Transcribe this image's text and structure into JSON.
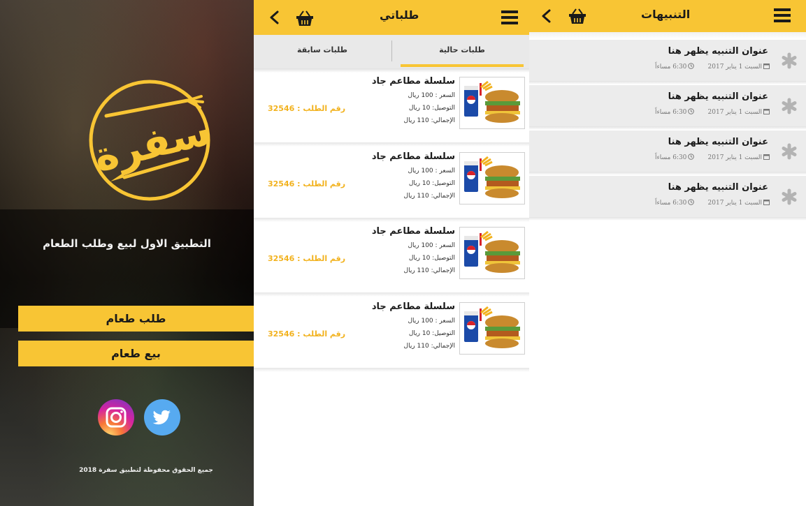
{
  "colors": {
    "accent": "#f8c534",
    "order_number": "#f2b21e",
    "card_bg": "#ececec",
    "twitter": "#57aaf0"
  },
  "splash": {
    "logo_text": "سفرة",
    "tagline": "التطبيق الاول لبيع وطلب الطعام",
    "order_food_button": "طلب طعام",
    "sell_food_button": "بيع طعام",
    "social": [
      "instagram-icon",
      "twitter-icon"
    ],
    "copyright": "جميع الحقوق محفوظة لتطبيق سفرة 2018"
  },
  "orders": {
    "title": "طلباتي",
    "tabs": {
      "current": "طلبات حالية",
      "previous": "طلبات سابقة"
    },
    "items": [
      {
        "name": "سلسلة مطاعم جاد",
        "price": "السعر : 100 ريال",
        "delivery": "التوصيل:  10 ريال",
        "total": "الإجمالي: 110 ريال",
        "order_no": "رقم الطلب : 32546"
      },
      {
        "name": "سلسلة مطاعم جاد",
        "price": "السعر : 100 ريال",
        "delivery": "التوصيل:  10 ريال",
        "total": "الإجمالي: 110 ريال",
        "order_no": "رقم الطلب : 32546"
      },
      {
        "name": "سلسلة مطاعم جاد",
        "price": "السعر : 100 ريال",
        "delivery": "التوصيل:  10 ريال",
        "total": "الإجمالي: 110 ريال",
        "order_no": "رقم الطلب : 32546"
      },
      {
        "name": "سلسلة مطاعم جاد",
        "price": "السعر : 100 ريال",
        "delivery": "التوصيل:  10 ريال",
        "total": "الإجمالي: 110 ريال",
        "order_no": "رقم الطلب : 32546"
      }
    ]
  },
  "notifications": {
    "title": "التنبيهات",
    "items": [
      {
        "title": "عنوان التنبيه يظهر هنا",
        "date": "السبت 1 يناير 2017",
        "time": "6:30 مساءاً"
      },
      {
        "title": "عنوان التنبيه يظهر هنا",
        "date": "السبت 1 يناير 2017",
        "time": "6:30 مساءاً"
      },
      {
        "title": "عنوان التنبيه يظهر هنا",
        "date": "السبت 1 يناير 2017",
        "time": "6:30 مساءاً"
      },
      {
        "title": "عنوان التنبيه يظهر هنا",
        "date": "السبت 1 يناير 2017",
        "time": "6:30 مساءاً"
      }
    ]
  }
}
